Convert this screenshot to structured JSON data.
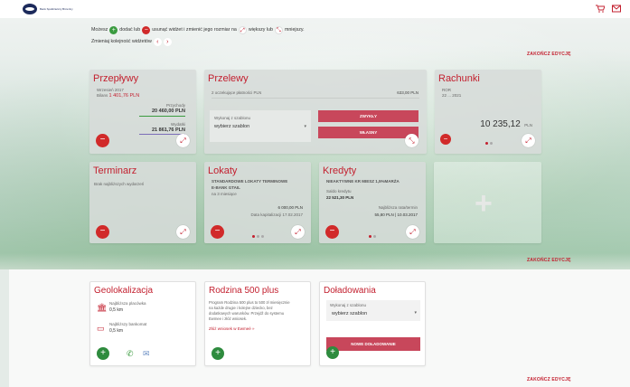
{
  "logo": {
    "text": "Bank Spółdzielczy Brzeziny"
  },
  "intro": {
    "line1_a": "Możesz",
    "line1_b": "dodać lub",
    "line1_c": "usunąć widżet i zmienić jego rozmiar na",
    "line1_d": "większy lub",
    "line1_e": "mniejszy.",
    "line2": "Zmieniaj kolejność widżetów"
  },
  "end_edit": "ZAKOŃCZ EDYCJĘ",
  "przeplywy": {
    "title": "Przepływy",
    "period": "Wrzesień 2017",
    "bilans_label": "Bilans",
    "bilans_value": "1 401,76 PLN",
    "przychody_label": "Przychody",
    "przychody_value": "20 460,00 PLN",
    "wydatki_label": "Wydatki",
    "wydatki_value": "21 861,76 PLN"
  },
  "przelewy": {
    "title": "Przelewy",
    "pending": "2 oczekujące płatności PLN",
    "pending_amount": "633,00 PLN",
    "template_label": "Wykonaj z szablonu",
    "template_placeholder": "wybierz szablon",
    "zwykly": "ZWYKŁY",
    "wlasny": "WŁASNY"
  },
  "rachunki": {
    "title": "Rachunki",
    "name": "ROR",
    "number": "22 ... 2021",
    "balance": "10 235,12",
    "currency": "PLN"
  },
  "terminarz": {
    "title": "Terminarz",
    "empty": "Brak najbliższych wydarzeń"
  },
  "lokaty": {
    "title": "Lokaty",
    "name_line1": "STANDARDOWE LOKATY TERMINOWE",
    "name_line2": "E-BANK GTAIL",
    "term": "na 3 miesiące",
    "amount": "6 000,00 PLN",
    "date": "Data kapitalizacji 17.02.2017"
  },
  "kredyty": {
    "title": "Kredyty",
    "name": "NIEAKTYWNE KR MIESZ 1,5%MARŻA",
    "saldo_label": "Saldo kredytu",
    "saldo_value": "22 521,30 PLN",
    "next_label": "Najbliższa rata/termin",
    "next_value": "55,80 PLN | 10.03.2017"
  },
  "geolokalizacja": {
    "title": "Geolokalizacja",
    "placowka_label": "Najbliższa placówka",
    "placowka_value": "0,5 km",
    "bankomat_label": "Najbliższy bankomat",
    "bankomat_value": "0,5 km"
  },
  "rodzina": {
    "title": "Rodzina 500 plus",
    "text": "Program Rodzina 500 plus to 500 zł miesięcznie na każde drugie i kolejne dziecko, bez dodatkowych warunków. Przejdź do systemu Ewmee i złóż wniosek.",
    "link": "Złóż wniosek w Ewmeé »"
  },
  "doladowania": {
    "title": "Doładowania",
    "template_label": "Wykonaj z szablonu",
    "template_placeholder": "wybierz szablon",
    "button": "NOWE DOŁADOWANIE"
  },
  "colors": {
    "accent": "#c3202f",
    "green": "#2e8b3e",
    "button": "#c8475b"
  }
}
